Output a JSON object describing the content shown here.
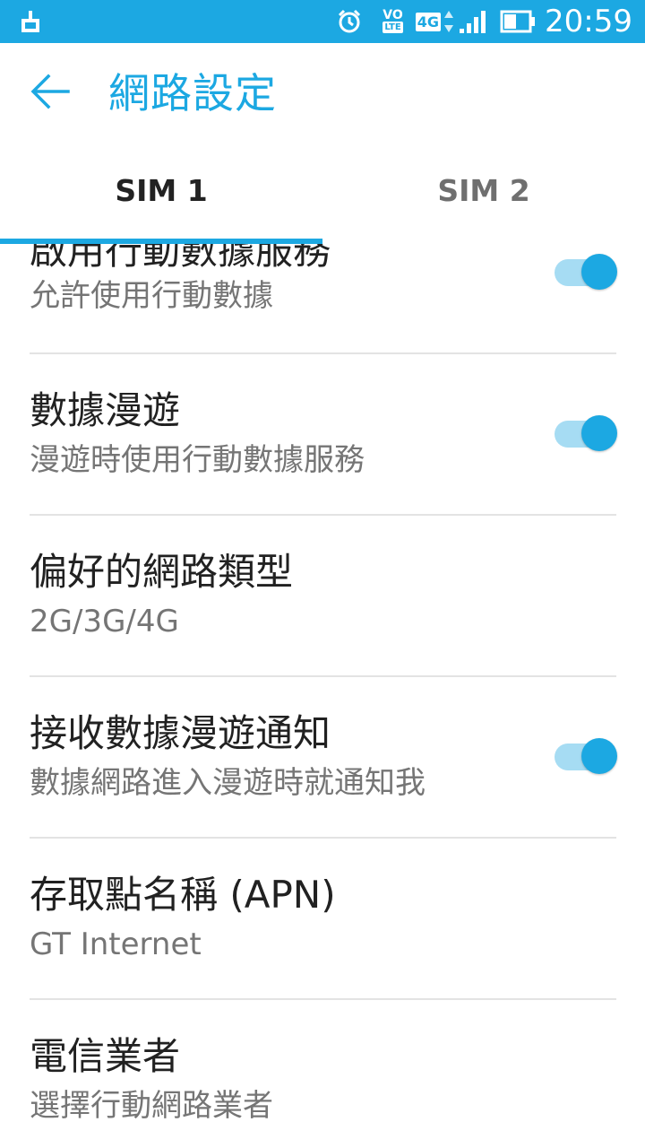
{
  "status_bar": {
    "time": "20:59",
    "network_badge": "4G",
    "volte_top": "VO",
    "volte_bottom": "LTE",
    "icons": [
      "notification-icon",
      "alarm-icon",
      "volte-icon",
      "4g-icon",
      "signal-icon",
      "battery-icon"
    ]
  },
  "header": {
    "title": "網路設定",
    "back_icon": "arrow-left-icon"
  },
  "tabs": [
    {
      "label": "SIM 1",
      "selected": true
    },
    {
      "label": "SIM 2",
      "selected": false
    }
  ],
  "settings": [
    {
      "title": "啟用行動數據服務",
      "subtitle": "允許使用行動數據",
      "toggle": true,
      "on": true
    },
    {
      "title": "數據漫遊",
      "subtitle": "漫遊時使用行動數據服務",
      "toggle": true,
      "on": true
    },
    {
      "title": "偏好的網路類型",
      "subtitle": "2G/3G/4G",
      "toggle": false
    },
    {
      "title": "接收數據漫遊通知",
      "subtitle": "數據網路進入漫遊時就通知我",
      "toggle": true,
      "on": true
    },
    {
      "title": "存取點名稱 (APN)",
      "subtitle": "GT Internet",
      "toggle": false
    },
    {
      "title": "電信業者",
      "subtitle": "選擇行動網路業者",
      "toggle": false
    }
  ],
  "colors": {
    "accent": "#1ca8e2",
    "switch_track_on": "#a6dcf3",
    "divider": "#e3e3e3"
  }
}
